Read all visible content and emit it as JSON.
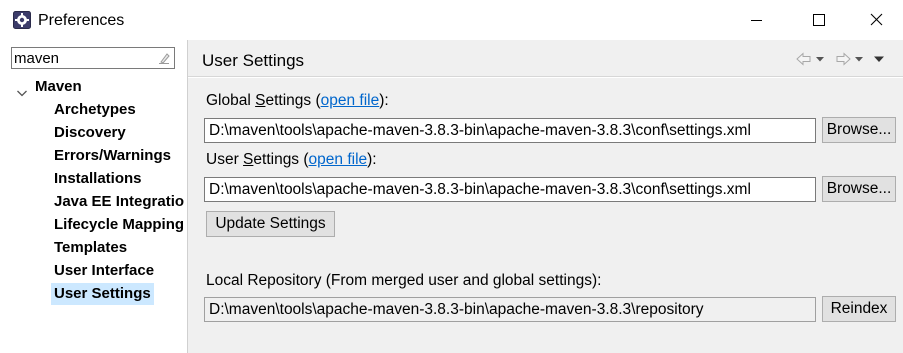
{
  "window": {
    "title": "Preferences",
    "icons": {
      "app": "eclipse-gear-icon",
      "minimize": "minimize-icon",
      "maximize": "maximize-icon",
      "close": "close-icon"
    }
  },
  "sidebar": {
    "filter_value": "maven",
    "filter_clear_icon": "clear-filter-icon",
    "root": {
      "label": "Maven",
      "expanded": true
    },
    "items": [
      {
        "label": "Archetypes",
        "selected": false
      },
      {
        "label": "Discovery",
        "selected": false
      },
      {
        "label": "Errors/Warnings",
        "selected": false
      },
      {
        "label": "Installations",
        "selected": false
      },
      {
        "label": "Java EE Integration",
        "selected": false
      },
      {
        "label": "Lifecycle Mappings",
        "selected": false
      },
      {
        "label": "Templates",
        "selected": false
      },
      {
        "label": "User Interface",
        "selected": false
      },
      {
        "label": "User Settings",
        "selected": true
      }
    ],
    "selection_color": "#cce8ff"
  },
  "main": {
    "page_title": "User Settings",
    "nav": {
      "back": "back-arrow-icon",
      "forward": "forward-arrow-icon",
      "menu": "view-menu-icon"
    },
    "global_settings": {
      "label_before": "Global ",
      "label_mnemonic": "S",
      "label_after": "ettings (",
      "link": "open file",
      "label_end": "):",
      "path": "D:\\maven\\tools\\apache-maven-3.8.3-bin\\apache-maven-3.8.3\\conf\\settings.xml",
      "browse_label": "Browse..."
    },
    "user_settings": {
      "label_before": "User ",
      "label_mnemonic": "S",
      "label_after": "ettings (",
      "link": "open file",
      "label_end": "):",
      "path": "D:\\maven\\tools\\apache-maven-3.8.3-bin\\apache-maven-3.8.3\\conf\\settings.xml",
      "browse_label": "Browse..."
    },
    "update_button": "Update Settings",
    "local_repo": {
      "label": "Local Repository (From merged user and global settings):",
      "path": "D:\\maven\\tools\\apache-maven-3.8.3-bin\\apache-maven-3.8.3\\repository",
      "reindex_label": "Reindex"
    },
    "link_color": "#0066cc",
    "background": "#f0f0f0"
  }
}
